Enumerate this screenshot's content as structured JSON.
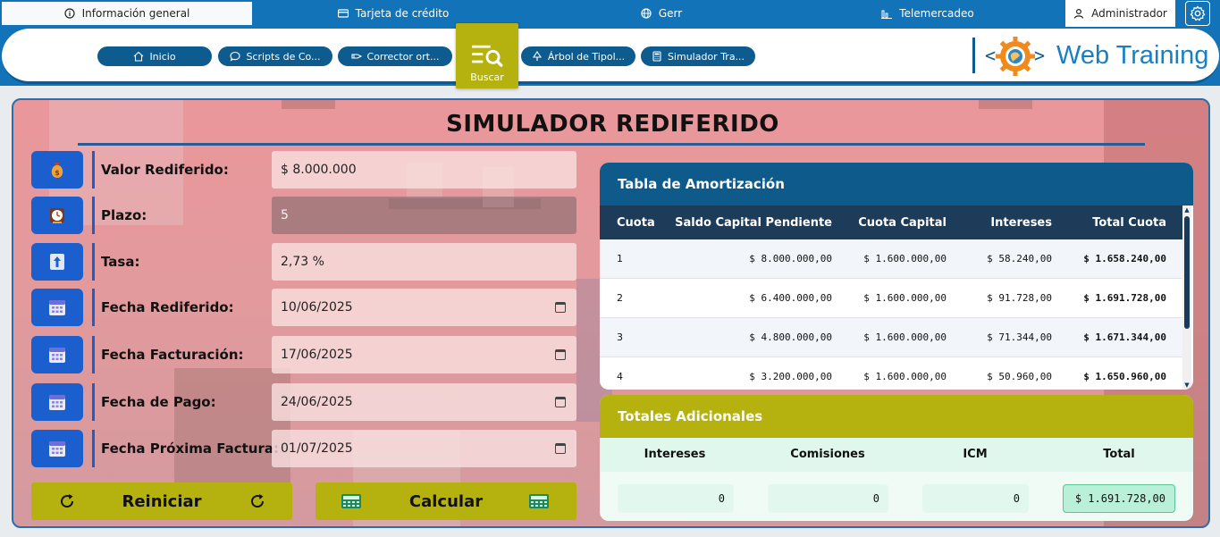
{
  "top_tabs": [
    {
      "label": "Información general",
      "icon": "info-icon",
      "active": true
    },
    {
      "label": "Tarjeta de crédito",
      "icon": "credit-card-icon"
    },
    {
      "label": "Gerr",
      "icon": "globe-icon"
    },
    {
      "label": "Telemercadeo",
      "icon": "chart-icon"
    }
  ],
  "user": {
    "label": "Administrador",
    "icon": "user-icon"
  },
  "settings_icon": "gear-icon",
  "nav": [
    {
      "label": "Inicio",
      "icon": "home-icon"
    },
    {
      "label": "Scripts de Co...",
      "icon": "chat-icon"
    },
    {
      "label": "Corrector ort...",
      "icon": "spellcheck-icon"
    },
    {
      "label": "Árbol de Tipol...",
      "icon": "tree-icon"
    },
    {
      "label": "Simulador Tra...",
      "icon": "calculator-icon"
    }
  ],
  "search": {
    "label": "Buscar",
    "icon": "search-icon"
  },
  "brand": {
    "name": "Web Training",
    "color": "#1a7fc2"
  },
  "simulator": {
    "title": "SIMULADOR REDIFERIDO",
    "fields": [
      {
        "label": "Valor Rediferido:",
        "value": "$ 8.000.000",
        "icon": "money-bag-icon"
      },
      {
        "label": "Plazo:",
        "value": "5",
        "icon": "clock-icon"
      },
      {
        "label": "Tasa:",
        "value": "2,73 %",
        "icon": "up-arrow-icon"
      },
      {
        "label": "Fecha Rediferido:",
        "value": "10/06/2025",
        "icon": "calendar-icon"
      },
      {
        "label": "Fecha Facturación:",
        "value": "17/06/2025",
        "icon": "calendar-icon"
      },
      {
        "label": "Fecha de Pago:",
        "value": "24/06/2025",
        "icon": "calendar-icon"
      },
      {
        "label": "Fecha Próxima Factura:",
        "value": "01/07/2025",
        "icon": "calendar-icon"
      }
    ],
    "buttons": {
      "reset": "Reiniciar",
      "calculate": "Calcular"
    }
  },
  "amortization": {
    "title": "Tabla de Amortización",
    "columns": [
      "Cuota",
      "Saldo Capital Pendiente",
      "Cuota Capital",
      "Intereses",
      "Total Cuota"
    ],
    "rows": [
      [
        "1",
        "$ 8.000.000,00",
        "$ 1.600.000,00",
        "$ 58.240,00",
        "$ 1.658.240,00"
      ],
      [
        "2",
        "$ 6.400.000,00",
        "$ 1.600.000,00",
        "$ 91.728,00",
        "$ 1.691.728,00"
      ],
      [
        "3",
        "$ 4.800.000,00",
        "$ 1.600.000,00",
        "$ 71.344,00",
        "$ 1.671.344,00"
      ],
      [
        "4",
        "$ 3.200.000,00",
        "$ 1.600.000,00",
        "$ 50.960,00",
        "$ 1.650.960,00"
      ]
    ]
  },
  "totals": {
    "title": "Totales Adicionales",
    "labels": [
      "Intereses",
      "Comisiones",
      "ICM",
      "Total"
    ],
    "values": [
      "0",
      "0",
      "0",
      "$ 1.691.728,00"
    ]
  },
  "colors": {
    "primary": "#1273b8",
    "navy": "#0e5a8a",
    "olive": "#b5b20f",
    "field_icon": "#1b5fcf"
  }
}
